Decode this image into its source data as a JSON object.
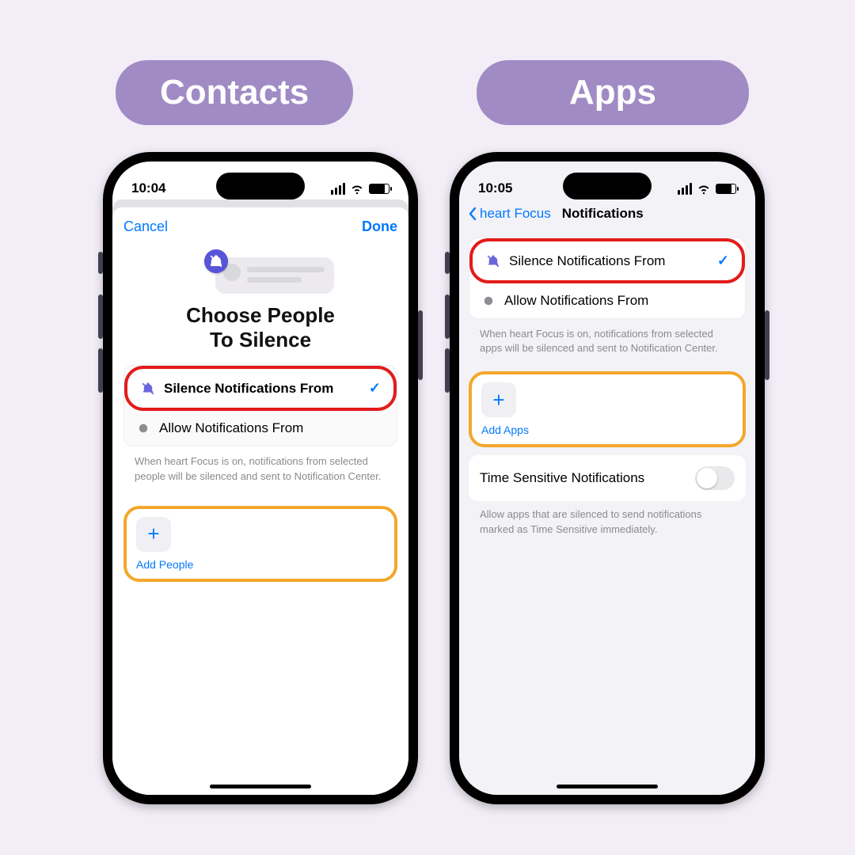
{
  "header": {
    "contacts_label": "Contacts",
    "apps_label": "Apps"
  },
  "left": {
    "status_time": "10:04",
    "cancel": "Cancel",
    "done": "Done",
    "title": "Choose People\nTo Silence",
    "silence_label": "Silence Notifications From",
    "allow_label": "Allow Notifications From",
    "hint": "When heart Focus is on, notifications from selected people will be silenced and sent to Notification Center.",
    "add_label": "Add People"
  },
  "right": {
    "status_time": "10:05",
    "back_label": "heart Focus",
    "page_title": "Notifications",
    "silence_label": "Silence Notifications From",
    "allow_label": "Allow Notifications From",
    "hint": "When heart Focus is on, notifications from selected apps will be silenced and sent to Notification Center.",
    "add_label": "Add Apps",
    "time_sensitive_label": "Time Sensitive Notifications",
    "time_sensitive_hint": "Allow apps that are silenced to send notifications marked as Time Sensitive immediately."
  },
  "colors": {
    "accent": "#007aff",
    "highlight_red": "#e31b1b",
    "highlight_orange": "#f3a72b",
    "pill_bg": "#a08bc4"
  }
}
